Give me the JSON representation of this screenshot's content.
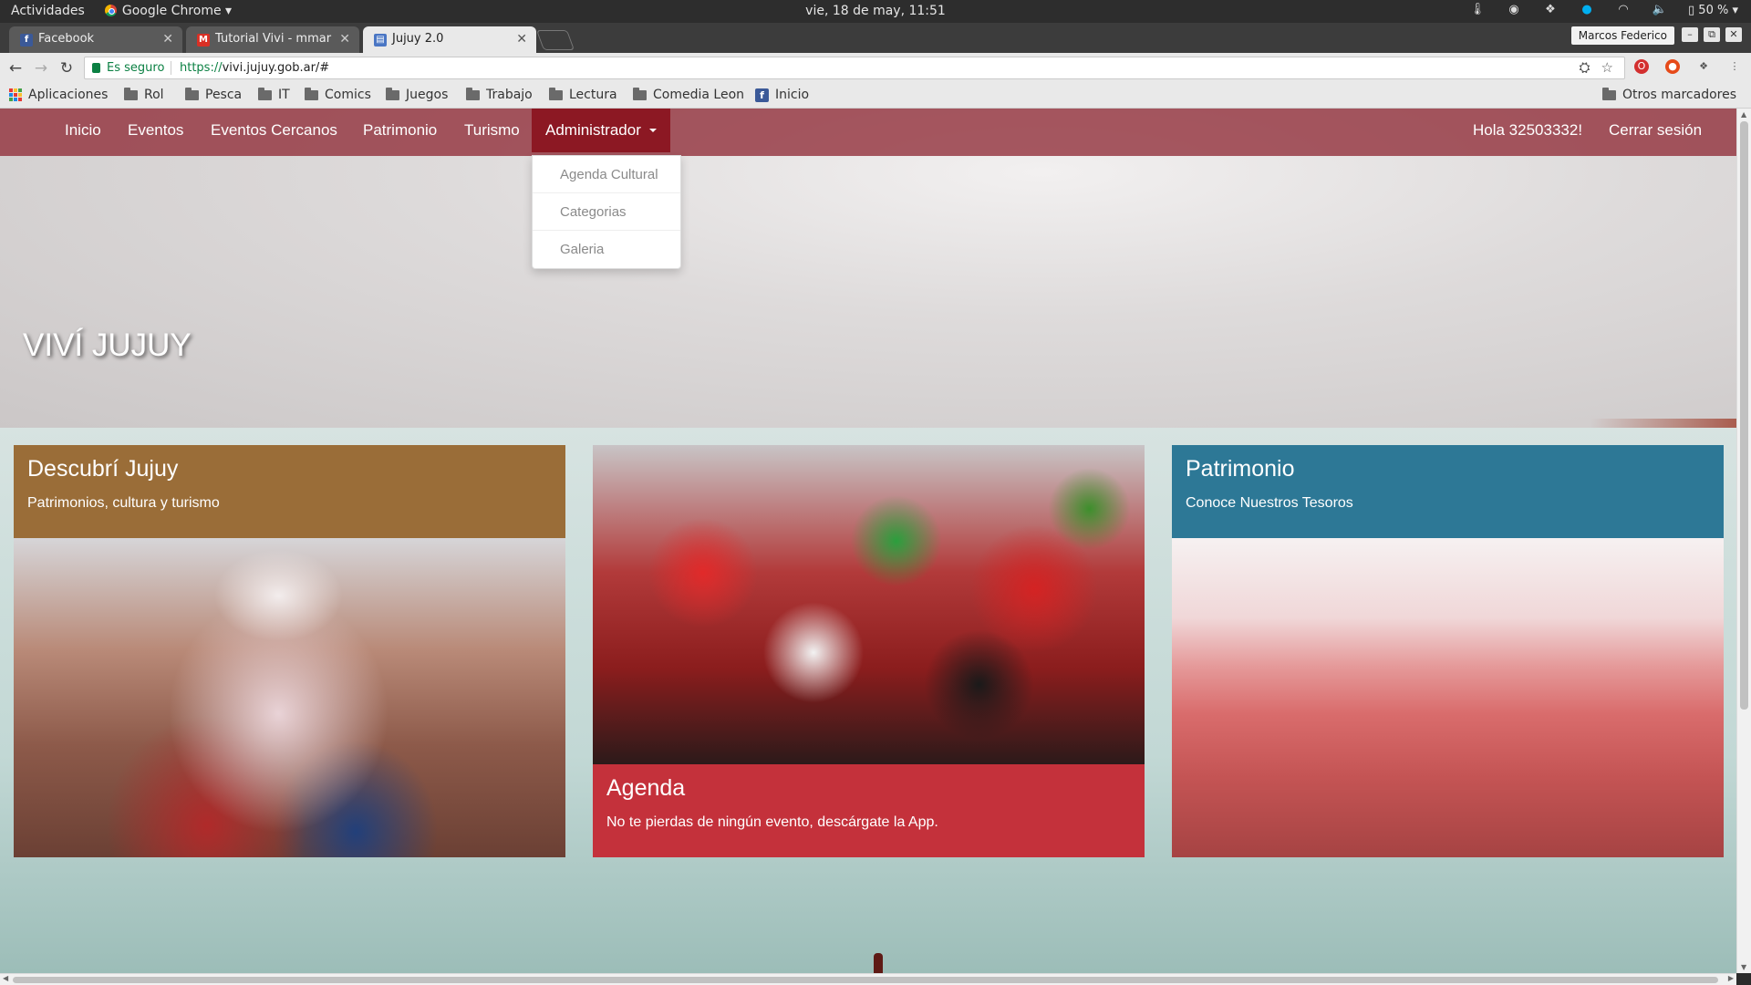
{
  "os_bar": {
    "activities": "Actividades",
    "app_name": "Google Chrome",
    "datetime": "vie, 18 de may, 11:51",
    "battery": "50 %"
  },
  "tabs": [
    {
      "title": "Facebook",
      "favicon": "f",
      "favicon_color": "#3b5998"
    },
    {
      "title": "Tutorial Vivi - mmar",
      "favicon": "M",
      "favicon_color": "#d93025"
    },
    {
      "title": "Jujuy 2.0",
      "favicon": "▤",
      "favicon_color": "#4a76c4"
    }
  ],
  "window": {
    "profile": "Marcos Federico",
    "minimize": "–",
    "restore": "⧉",
    "close": "✕"
  },
  "address": {
    "secure_label": "Es seguro",
    "url_scheme": "https://",
    "url_rest": "vivi.jujuy.gob.ar/#"
  },
  "bookmarks": {
    "apps": "Aplicaciones",
    "folders": [
      "Rol",
      "Pesca",
      "IT",
      "Comics",
      "Juegos",
      "Trabajo",
      "Lectura",
      "Comedia Leon"
    ],
    "inicio": "Inicio",
    "other": "Otros marcadores"
  },
  "nav": {
    "items": [
      "Inicio",
      "Eventos",
      "Eventos Cercanos",
      "Patrimonio",
      "Turismo"
    ],
    "admin": "Administrador",
    "greeting": "Hola 32503332!",
    "logout": "Cerrar sesión",
    "dropdown": [
      "Agenda Cultural",
      "Categorias",
      "Galeria"
    ]
  },
  "hero": {
    "title": "VIVÍ JUJUY"
  },
  "cards": [
    {
      "title": "Descubrí Jujuy",
      "subtitle": "Patrimonios, cultura y turismo",
      "color": "#9a6d38"
    },
    {
      "title": "Agenda",
      "subtitle": "No te pierdas de ningún evento, descárgate la App.",
      "color": "#c4313b"
    },
    {
      "title": "Patrimonio",
      "subtitle": "Conoce Nuestros Tesoros",
      "color": "#2d7896"
    }
  ],
  "colors": {
    "navbar": "#8f2b37",
    "admin_active": "#8c1823"
  }
}
